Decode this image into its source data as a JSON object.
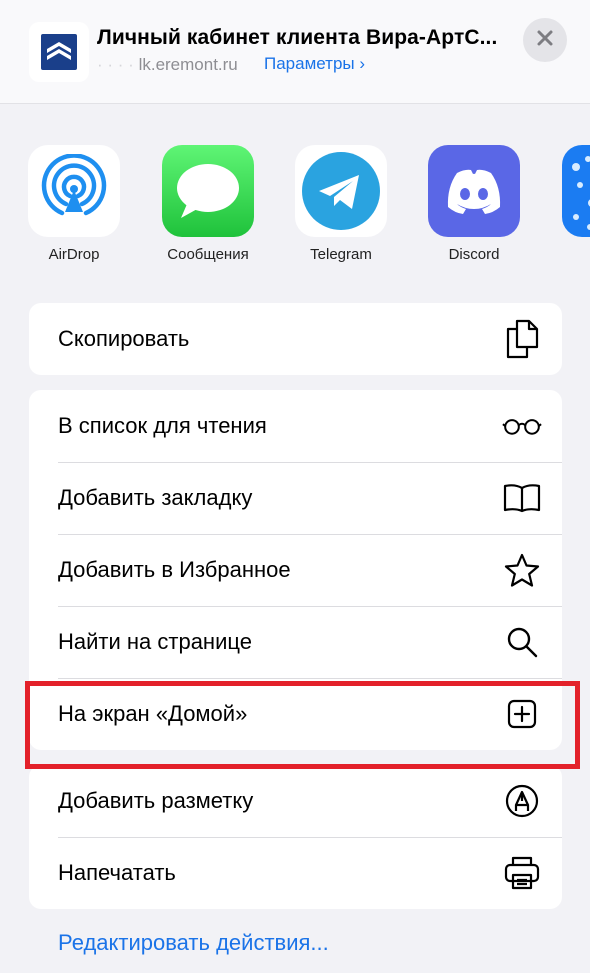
{
  "header": {
    "title": "Личный кабинет клиента Вира-АртС...",
    "url_hidden": "· · · ·",
    "url_visible": "lk.eremont.ru",
    "params_label": "Параметры",
    "params_chevron": "›"
  },
  "apps": [
    {
      "label": "AirDrop",
      "icon": "airdrop-icon"
    },
    {
      "label": "Сообщения",
      "icon": "messages-icon"
    },
    {
      "label": "Telegram",
      "icon": "telegram-icon"
    },
    {
      "label": "Discord",
      "icon": "discord-icon"
    },
    {
      "label": "",
      "icon": "partial-app-icon"
    }
  ],
  "actions": {
    "copy": {
      "label": "Скопировать",
      "icon": "copy-icon"
    },
    "reading_list": {
      "label": "В список для чтения",
      "icon": "glasses-icon"
    },
    "bookmark": {
      "label": "Добавить закладку",
      "icon": "book-icon"
    },
    "favorites": {
      "label": "Добавить в Избранное",
      "icon": "star-icon"
    },
    "find": {
      "label": "Найти на странице",
      "icon": "search-icon"
    },
    "home_screen": {
      "label": "На экран «Домой»",
      "icon": "plus-square-icon"
    },
    "markup": {
      "label": "Добавить разметку",
      "icon": "markup-icon"
    },
    "print": {
      "label": "Напечатать",
      "icon": "printer-icon"
    }
  },
  "edit_actions_label": "Редактировать действия...",
  "colors": {
    "accent": "#1a73e8",
    "highlight": "#e3212a",
    "background": "#f2f2f6"
  }
}
